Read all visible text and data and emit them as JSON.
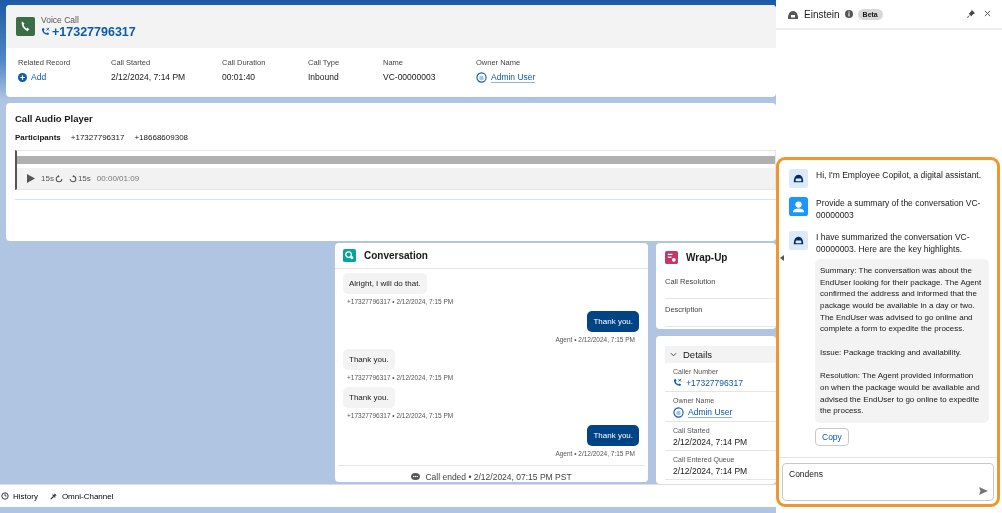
{
  "record_header": {
    "object": "Voice Call",
    "title": "+17327796317",
    "fields": [
      {
        "label": "Related Record",
        "value": "Add",
        "kind": "action"
      },
      {
        "label": "Call Started",
        "value": "2/12/2024, 7:14 PM",
        "kind": "text"
      },
      {
        "label": "Call Duration",
        "value": "00:01:40",
        "kind": "text"
      },
      {
        "label": "Call Type",
        "value": "Inbound",
        "kind": "text"
      },
      {
        "label": "Name",
        "value": "VC-00000003",
        "kind": "text"
      },
      {
        "label": "Owner Name",
        "value": "Admin User",
        "kind": "user"
      }
    ]
  },
  "audio_player": {
    "title": "Call Audio Player",
    "participants_label": "Participants",
    "participants": [
      "+17327796317",
      "+18668609308"
    ],
    "skip_back": "15s",
    "skip_forward": "15s",
    "time": "00:00/01:09"
  },
  "conversation": {
    "title": "Conversation",
    "messages": [
      {
        "kind": "customer",
        "text": "Alright, I will do that.",
        "meta": "+17327796317 • 2/12/2024, 7:15 PM"
      },
      {
        "kind": "agent",
        "text": "Thank you.",
        "meta": "Agent • 2/12/2024, 7:15 PM"
      },
      {
        "kind": "customer",
        "text": "Thank you.",
        "meta": "+17327796317 • 2/12/2024, 7:15 PM"
      },
      {
        "kind": "customer",
        "text": "Thank you.",
        "meta": "+17327796317 • 2/12/2024, 7:15 PM"
      },
      {
        "kind": "agent",
        "text": "Thank you.",
        "meta": "Agent • 2/12/2024, 7:15 PM"
      }
    ],
    "ended": "Call ended • 2/12/2024, 07:15 PM PST"
  },
  "wrap_up": {
    "title": "Wrap-Up",
    "fields": [
      "Call Resolution",
      "Description"
    ]
  },
  "details": {
    "title": "Details",
    "expanded": true,
    "fields": [
      {
        "label": "Caller Number",
        "value": "+17327796317",
        "kind": "phone"
      },
      {
        "label": "Owner Name",
        "value": "Admin User",
        "kind": "user"
      },
      {
        "label": "Call Started",
        "value": "2/12/2024, 7:14 PM",
        "kind": "text"
      },
      {
        "label": "Call Entered Queue",
        "value": "2/12/2024, 7:14 PM",
        "kind": "text"
      }
    ]
  },
  "utility_bar": [
    {
      "label": "History",
      "kind": "history"
    },
    {
      "label": "Omni-Channel",
      "kind": "omni"
    }
  ],
  "assistant": {
    "title": "Einstein",
    "badge": "Beta",
    "messages": [
      {
        "kind": "bot",
        "text": "Hi, I'm Employee Copilot, a digital assistant."
      },
      {
        "kind": "user",
        "text": "Provide a summary of the conversation VC-00000003"
      },
      {
        "kind": "bot",
        "text": "I have summarized the conversation VC-00000003. Here are the key highlights.",
        "summary": [
          "Summary: The conversation was about the EndUser looking for their package. The Agent confirmed the address and informed that the package would be available in a day or two. The EndUser was advised to go online and complete a form to expedite the process.",
          "Issue: Package tracking and availability.",
          "Resolution: The Agent provided information on when the package would be available and advised the EndUser to go online to expedite the process."
        ],
        "action": "Copy"
      }
    ],
    "input": {
      "value": "Condens"
    }
  }
}
